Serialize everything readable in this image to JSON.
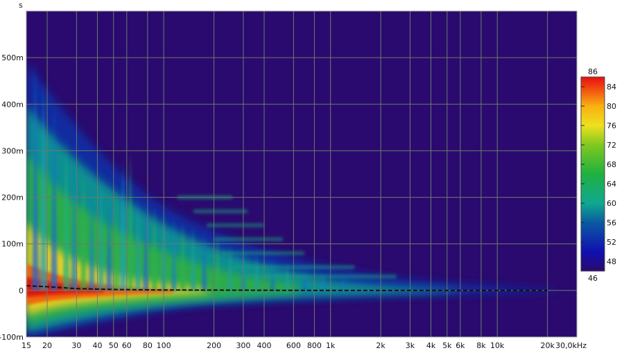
{
  "chart_data": {
    "type": "heatmap",
    "title": "",
    "xlabel": "",
    "ylabel": "s",
    "x_scale": "log",
    "xlim": [
      15,
      30000
    ],
    "ylim": [
      -0.1,
      0.6
    ],
    "x_ticks": [
      {
        "value": 15,
        "label": "15"
      },
      {
        "value": 20,
        "label": "20"
      },
      {
        "value": 30,
        "label": "30"
      },
      {
        "value": 40,
        "label": "40"
      },
      {
        "value": 50,
        "label": "50"
      },
      {
        "value": 60,
        "label": "60"
      },
      {
        "value": 80,
        "label": "80"
      },
      {
        "value": 100,
        "label": "100"
      },
      {
        "value": 200,
        "label": "200"
      },
      {
        "value": 300,
        "label": "300"
      },
      {
        "value": 400,
        "label": "400"
      },
      {
        "value": 600,
        "label": "600"
      },
      {
        "value": 800,
        "label": "800"
      },
      {
        "value": 1000,
        "label": "1k"
      },
      {
        "value": 2000,
        "label": "2k"
      },
      {
        "value": 3000,
        "label": "3k"
      },
      {
        "value": 4000,
        "label": "4k"
      },
      {
        "value": 5000,
        "label": "5k"
      },
      {
        "value": 6000,
        "label": "6k"
      },
      {
        "value": 8000,
        "label": "8k"
      },
      {
        "value": 10000,
        "label": "10k"
      },
      {
        "value": 20000,
        "label": "20k"
      },
      {
        "value": 30000,
        "label": "30,0kHz"
      }
    ],
    "y_ticks": [
      {
        "value": 0.5,
        "label": "500m"
      },
      {
        "value": 0.4,
        "label": "400m"
      },
      {
        "value": 0.3,
        "label": "300m"
      },
      {
        "value": 0.2,
        "label": "200m"
      },
      {
        "value": 0.1,
        "label": "100m"
      },
      {
        "value": 0,
        "label": "0"
      },
      {
        "value": -0.1,
        "label": "-100m"
      }
    ],
    "colorbar": {
      "min": 46,
      "max": 86,
      "min_label": "46",
      "max_label": "86",
      "ticks": [
        48,
        52,
        56,
        60,
        64,
        68,
        72,
        76,
        80,
        84
      ]
    },
    "peak_delay_curve": [
      {
        "x": 15,
        "y": 0.01
      },
      {
        "x": 20,
        "y": 0.008
      },
      {
        "x": 30,
        "y": 0.004
      },
      {
        "x": 50,
        "y": 0.002
      },
      {
        "x": 100,
        "y": 0.001
      },
      {
        "x": 1000,
        "y": 0.0
      },
      {
        "x": 20000,
        "y": 0.0
      }
    ],
    "grid": true,
    "colors": {
      "background": "#2a0a6e",
      "grid": "#6e7b6e",
      "curve": "#111111"
    }
  }
}
